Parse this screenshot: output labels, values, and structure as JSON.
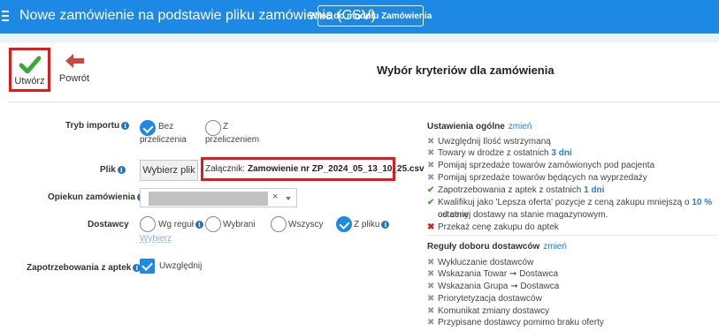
{
  "header": {
    "title": "Nowe zamówienie na podstawie pliku zamówienia (CSV)",
    "back_module_label": "Wróć do modułu Zamówienia"
  },
  "toolbar": {
    "create_label": "Utwórz",
    "back_label": "Powrót"
  },
  "section_title": "Wybór kryteriów dla zamówienia",
  "form": {
    "import_mode": {
      "label": "Tryb importu",
      "options": [
        {
          "line1": "Bez",
          "line2": "przeliczenia",
          "selected": true
        },
        {
          "line1": "Z",
          "line2": "przeliczeniem",
          "selected": false
        }
      ]
    },
    "file": {
      "label": "Plik",
      "choose_label": "Wybierz plik",
      "attachment_prefix": "Załącznik:",
      "attachment_name": "Zamowienie nr ZP_2024_05_13_10_25.csv"
    },
    "guardian": {
      "label": "Opiekun zamówienia",
      "clear_symbol": "×"
    },
    "suppliers": {
      "label": "Dostawcy",
      "options": [
        {
          "text": "Wg reguł",
          "selected": false
        },
        {
          "text": "Wybrani",
          "selected": false
        },
        {
          "text": "Wszyscy",
          "selected": false
        },
        {
          "text": "Z pliku",
          "selected": true
        }
      ],
      "choose_link": "Wybierz"
    },
    "pharmacy_demand": {
      "label": "Zapotrzebowania z aptek",
      "checkbox_label": "Uwzględnij",
      "checked": true
    }
  },
  "general_settings": {
    "title": "Ustawienia ogólne",
    "change_link": "zmień",
    "items": [
      {
        "status": "off",
        "text": "Uwzględnij Ilość wstrzymaną"
      },
      {
        "status": "off",
        "text": "Towary w drodze z ostatnich",
        "value": "3 dni"
      },
      {
        "status": "off",
        "text": "Pomijaj sprzedaże towarów zamówionych pod pacjenta"
      },
      {
        "status": "off",
        "text": "Pomijaj sprzedaże towarów będących na wyprzedaży"
      },
      {
        "status": "on",
        "text": "Zapotrzebowania z aptek z ostatnich",
        "value": "1 dni"
      },
      {
        "status": "on",
        "text": "Kwalifikuj jako 'Lepsza oferta' pozycje z ceną zakupu mniejszą o",
        "value": "10 %",
        "text_after": "od ceny",
        "line2": "ostatniej dostawy na stanie magazynowym."
      },
      {
        "status": "bad",
        "text": "Przekaż cenę zakupu do aptek"
      }
    ]
  },
  "supplier_rules": {
    "title": "Reguły doboru dostawców",
    "change_link": "zmień",
    "items": [
      {
        "status": "off",
        "text": "Wykluczanie dostawców"
      },
      {
        "status": "off",
        "text": "Wskazania Towar ➞ Dostawca"
      },
      {
        "status": "off",
        "text": "Wskazania Grupa ➞ Dostawca"
      },
      {
        "status": "off",
        "text": "Priorytetyzacja dostawców"
      },
      {
        "status": "off",
        "text": "Komunikat zmiany dostawcy"
      },
      {
        "status": "off",
        "text": "Przypisane dostawcy pomimo braku oferty"
      }
    ]
  },
  "colors": {
    "header_bg": "#1e88e5",
    "accent": "#1e88e5",
    "highlight_border": "#e01b1b",
    "link": "#2a7bd5",
    "ok": "#3fa63c"
  },
  "icons": {
    "menu": "hamburger-icon",
    "create": "checkmark-icon",
    "back": "arrow-left-icon",
    "info": "info-icon"
  }
}
